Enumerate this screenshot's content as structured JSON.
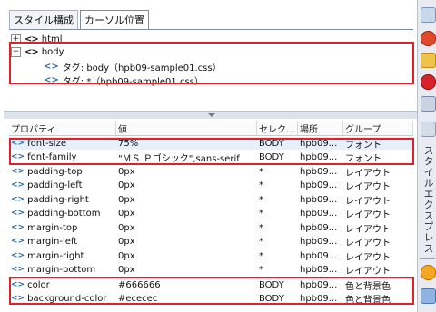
{
  "tabs": [
    {
      "label": "スタイル構成",
      "active": false
    },
    {
      "label": "カーソル位置",
      "active": true
    }
  ],
  "tree": [
    {
      "label": "html",
      "expander": "+",
      "icon": "code-icon"
    },
    {
      "label": "body",
      "expander": "−",
      "icon": "code-icon"
    },
    {
      "label": "タグ: body（hpb09-sample01.css）",
      "icon": "tag-icon"
    },
    {
      "label": "タグ: *（hpb09-sample01.css）",
      "icon": "tag-icon"
    }
  ],
  "table": {
    "headers": [
      "プロパティ",
      "値",
      "セレク...",
      "場所",
      "グループ"
    ],
    "rows": [
      {
        "prop": "font-size",
        "value": "75%",
        "selector": "BODY",
        "location": "hpb09...",
        "group": "フォント",
        "selected": true
      },
      {
        "prop": "font-family",
        "value": "\"ＭＳ Ｐゴシック\",sans-serif",
        "selector": "BODY",
        "location": "hpb09...",
        "group": "フォント"
      },
      {
        "prop": "padding-top",
        "value": "0px",
        "selector": "*",
        "location": "hpb09...",
        "group": "レイアウト"
      },
      {
        "prop": "padding-left",
        "value": "0px",
        "selector": "*",
        "location": "hpb09...",
        "group": "レイアウト"
      },
      {
        "prop": "padding-right",
        "value": "0px",
        "selector": "*",
        "location": "hpb09...",
        "group": "レイアウト"
      },
      {
        "prop": "padding-bottom",
        "value": "0px",
        "selector": "*",
        "location": "hpb09...",
        "group": "レイアウト"
      },
      {
        "prop": "margin-top",
        "value": "0px",
        "selector": "*",
        "location": "hpb09...",
        "group": "レイアウト"
      },
      {
        "prop": "margin-left",
        "value": "0px",
        "selector": "*",
        "location": "hpb09...",
        "group": "レイアウト"
      },
      {
        "prop": "margin-right",
        "value": "0px",
        "selector": "*",
        "location": "hpb09...",
        "group": "レイアウト"
      },
      {
        "prop": "margin-bottom",
        "value": "0px",
        "selector": "*",
        "location": "hpb09...",
        "group": "レイアウト"
      },
      {
        "prop": "color",
        "value": "#666666",
        "selector": "BODY",
        "location": "hpb09...",
        "group": "色と背景色"
      },
      {
        "prop": "background-color",
        "value": "#ececec",
        "selector": "BODY",
        "location": "hpb09...",
        "group": "色と背景色"
      }
    ]
  },
  "dock": {
    "label": "スタイルエクスプレス"
  },
  "colors": {
    "highlight": "#e2202c",
    "icon_blue": "#2a6aa6"
  }
}
